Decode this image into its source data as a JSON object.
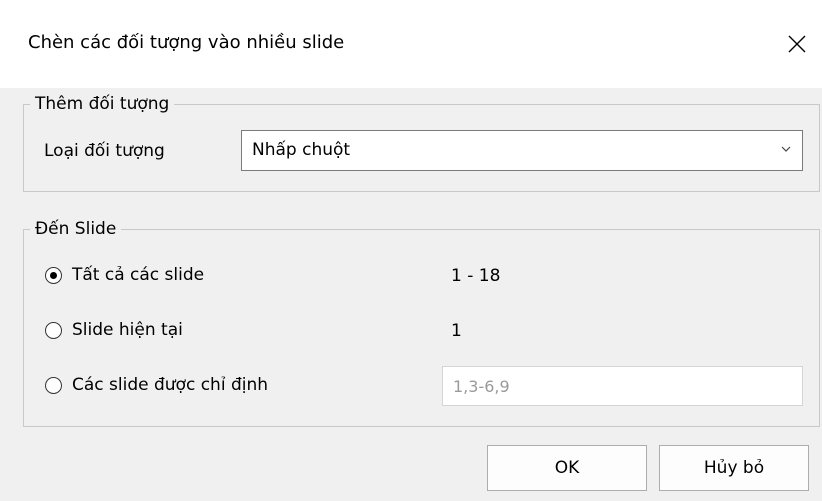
{
  "dialog": {
    "title": "Chèn các đối tượng vào nhiều slide"
  },
  "add_object": {
    "legend": "Thêm đối tượng",
    "type_label": "Loại đối tượng",
    "type_value": "Nhấp chuột"
  },
  "to_slide": {
    "legend": "Đến Slide",
    "options": [
      {
        "label": "Tất cả các slide",
        "value": "1 - 18",
        "checked": true
      },
      {
        "label": "Slide hiện tại",
        "value": "1",
        "checked": false
      },
      {
        "label": "Các slide được chỉ định",
        "placeholder": "1,3-6,9",
        "checked": false
      }
    ]
  },
  "buttons": {
    "ok": "OK",
    "cancel": "Hủy bỏ"
  }
}
